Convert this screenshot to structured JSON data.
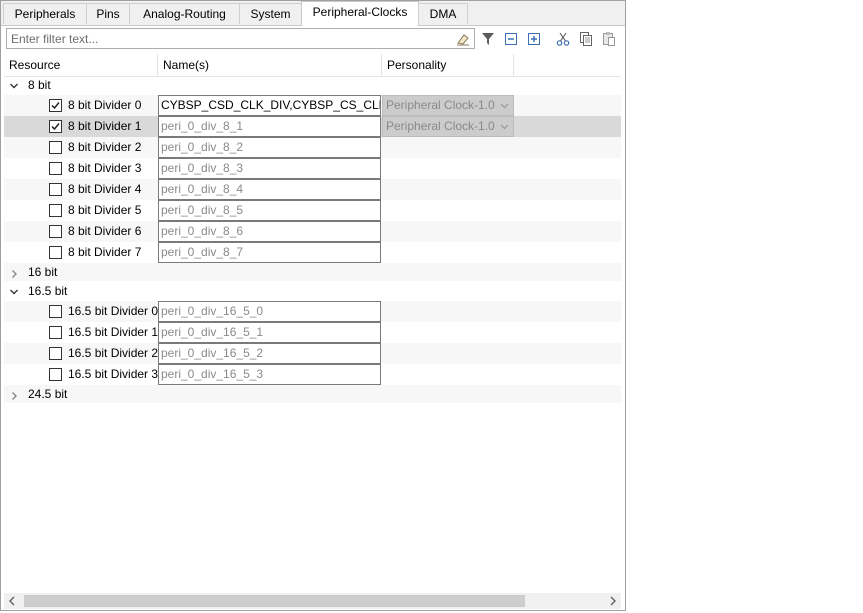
{
  "tabs": [
    {
      "label": "Peripherals"
    },
    {
      "label": "Pins"
    },
    {
      "label": "Analog-Routing"
    },
    {
      "label": "System"
    },
    {
      "label": "Peripheral-Clocks"
    },
    {
      "label": "DMA"
    }
  ],
  "active_tab": "Peripheral-Clocks",
  "filter": {
    "placeholder": "Enter filter text...",
    "value": ""
  },
  "toolbar_icons": [
    "eraser-icon",
    "filter-icon",
    "collapse-all-icon",
    "expand-all-icon",
    "cut-icon",
    "copy-icon",
    "paste-icon"
  ],
  "columns": {
    "resource": "Resource",
    "names": "Name(s)",
    "personality": "Personality"
  },
  "groups": [
    {
      "label": "8 bit",
      "expanded": true,
      "items": [
        {
          "label": "8 bit Divider 0",
          "checked": true,
          "name": "CYBSP_CSD_CLK_DIV,CYBSP_CS_CLK_DIV",
          "personality": "Peripheral Clock-1.0"
        },
        {
          "label": "8 bit Divider 1",
          "checked": true,
          "name": "peri_0_div_8_1",
          "personality": "Peripheral Clock-1.0"
        },
        {
          "label": "8 bit Divider 2",
          "checked": false,
          "name": "peri_0_div_8_2",
          "personality": ""
        },
        {
          "label": "8 bit Divider 3",
          "checked": false,
          "name": "peri_0_div_8_3",
          "personality": ""
        },
        {
          "label": "8 bit Divider 4",
          "checked": false,
          "name": "peri_0_div_8_4",
          "personality": ""
        },
        {
          "label": "8 bit Divider 5",
          "checked": false,
          "name": "peri_0_div_8_5",
          "personality": ""
        },
        {
          "label": "8 bit Divider 6",
          "checked": false,
          "name": "peri_0_div_8_6",
          "personality": ""
        },
        {
          "label": "8 bit Divider 7",
          "checked": false,
          "name": "peri_0_div_8_7",
          "personality": ""
        }
      ]
    },
    {
      "label": "16 bit",
      "expanded": false,
      "items": []
    },
    {
      "label": "16.5 bit",
      "expanded": true,
      "items": [
        {
          "label": "16.5 bit Divider 0",
          "checked": false,
          "name": "peri_0_div_16_5_0",
          "personality": ""
        },
        {
          "label": "16.5 bit Divider 1",
          "checked": false,
          "name": "peri_0_div_16_5_1",
          "personality": ""
        },
        {
          "label": "16.5 bit Divider 2",
          "checked": false,
          "name": "peri_0_div_16_5_2",
          "personality": ""
        },
        {
          "label": "16.5 bit Divider 3",
          "checked": false,
          "name": "peri_0_div_16_5_3",
          "personality": ""
        }
      ]
    },
    {
      "label": "24.5 bit",
      "expanded": false,
      "items": []
    }
  ],
  "selected_item": "8 bit Divider 1",
  "scrollbar_icons": [
    "scroll-left-icon",
    "scroll-right-icon"
  ]
}
